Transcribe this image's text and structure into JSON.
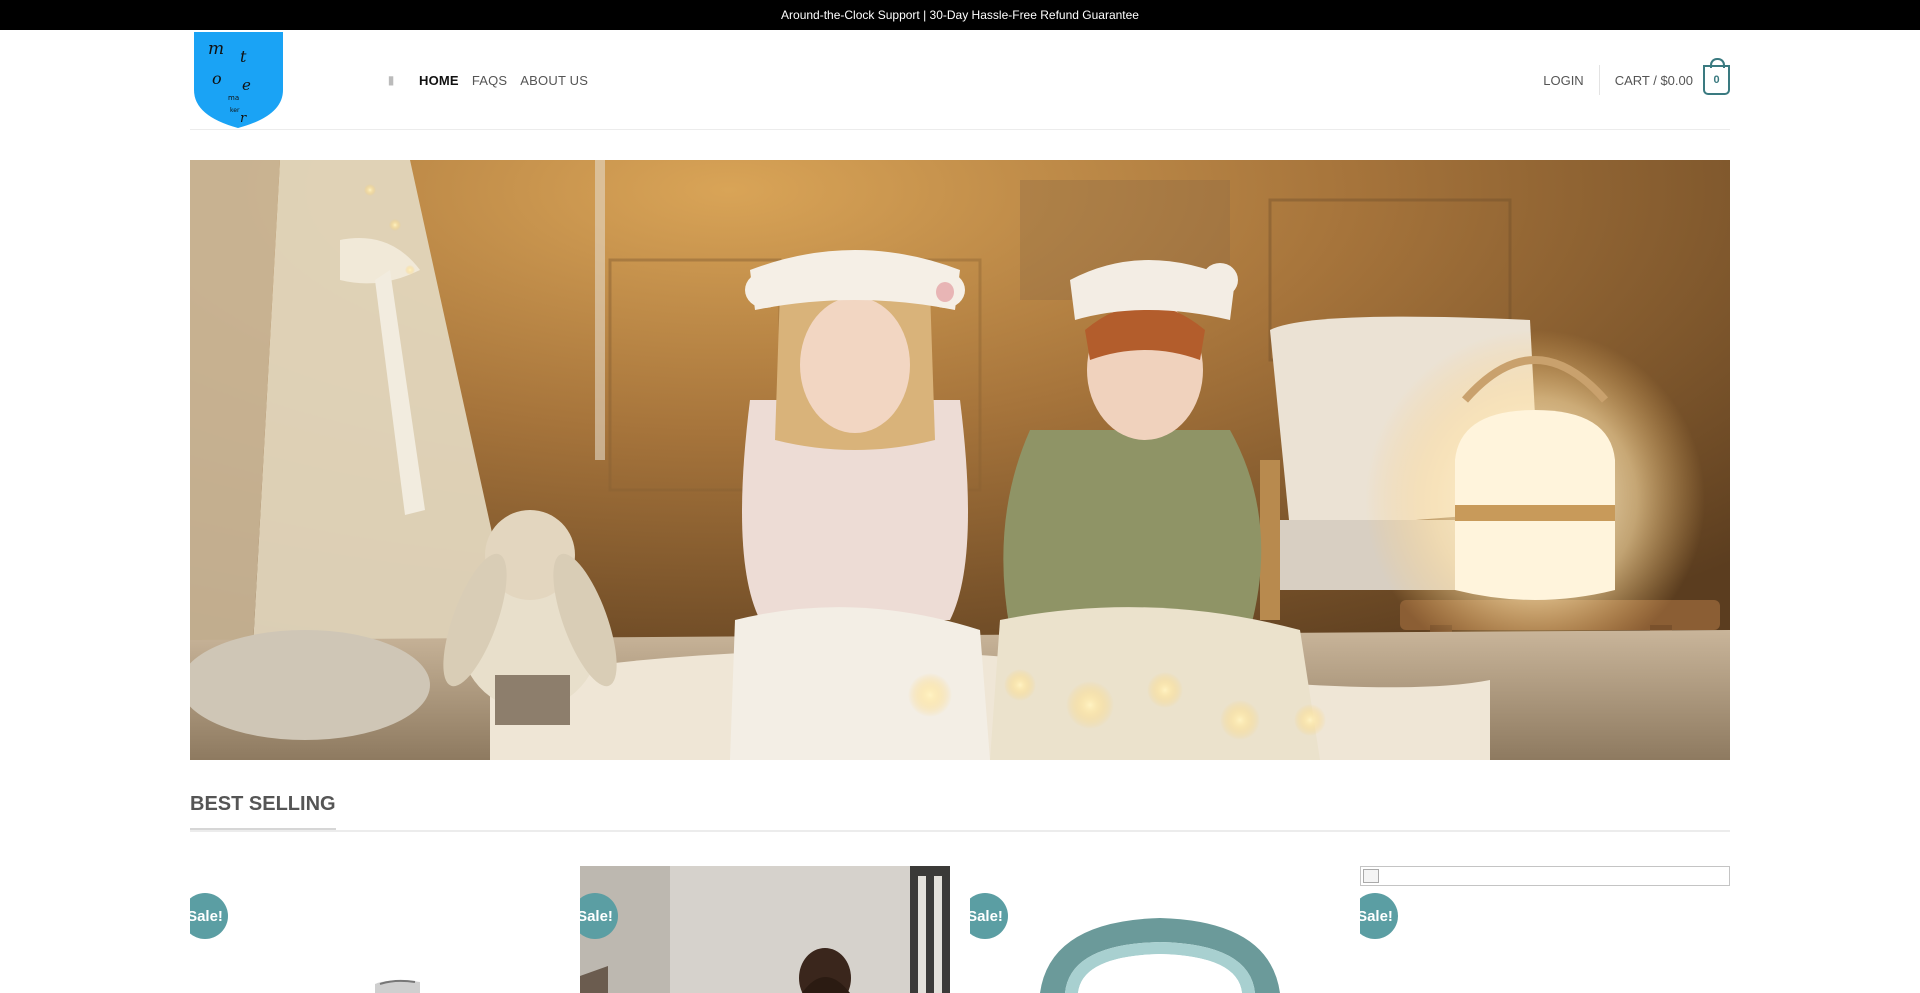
{
  "announcement": "Around-the-Clock Support | 30-Day Hassle-Free Refund Guarantee",
  "logo": {
    "text_lines": [
      "m t",
      "o e",
      "ma",
      "ker"
    ],
    "color": "#1aa3f5"
  },
  "nav": {
    "menu_icon": "menu-icon",
    "items": [
      {
        "label": "HOME",
        "active": true
      },
      {
        "label": "FAQS",
        "active": false
      },
      {
        "label": "ABOUT US",
        "active": false
      }
    ]
  },
  "account": {
    "login_label": "LOGIN",
    "cart_label": "CART / $0.00",
    "cart_count": "0"
  },
  "hero": {
    "scene": "two children wearing bear sleep masks sitting on a bed with fairy lights"
  },
  "best_selling": {
    "title": "BEST SELLING",
    "products": [
      {
        "badge": "Sale!"
      },
      {
        "badge": "Sale!"
      },
      {
        "badge": "Sale!"
      },
      {
        "badge": "Sale!"
      }
    ]
  },
  "colors": {
    "topbar_bg": "#000000",
    "accent": "#3a7a80",
    "badge": "#5b9ea3"
  }
}
